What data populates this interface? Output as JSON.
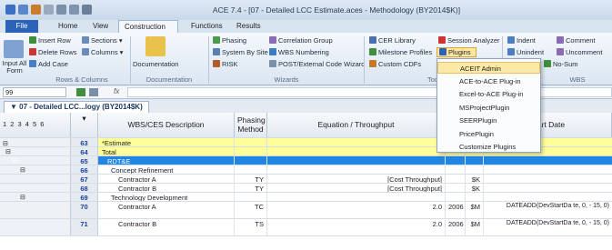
{
  "window": {
    "title": "ACE 7.4 - [07 - Detailed LCC Estimate.aces - Methodology (BY2014$K)]"
  },
  "tabs": [
    {
      "label": "File"
    },
    {
      "label": "Home"
    },
    {
      "label": "View"
    },
    {
      "label": "Construction"
    },
    {
      "label": "Functions"
    },
    {
      "label": "Results"
    }
  ],
  "ribbon": {
    "input_all": "Input All Form",
    "insert_row": "Insert Row",
    "delete_rows": "Delete Rows",
    "add_case": "Add Case",
    "sections": "Sections",
    "columns": "Columns",
    "documentation": "Documentation",
    "phasing": "Phasing",
    "system_by_site": "System By Site",
    "risk": "RISK",
    "correlation_group": "Correlation Group",
    "wbs_numbering": "WBS Numbering",
    "post_external": "POST/External Code Wizard",
    "cer_library": "CER Library",
    "milestone_profiles": "Milestone Profiles",
    "custom_cdfs": "Custom CDFs",
    "session_analyzer": "Session Analyzer",
    "plugins": "Plugins",
    "indent": "Indent",
    "unindent": "Unindent",
    "comment": "Comment",
    "uncomment": "Uncomment",
    "no_sum": "No-Sum",
    "groups": {
      "rows_columns": "Rows & Columns",
      "documentation": "Documentation",
      "wizards": "Wizards",
      "tools": "Too",
      "wbs": "WBS"
    }
  },
  "formula": {
    "name_box": "99"
  },
  "doc_tab": {
    "label": "07 - Detailed LCC...logy (BY2014$K)"
  },
  "grid": {
    "levels": "1 2 3 4 5 6",
    "columns": {
      "desc": "WBS/CES Description",
      "phasing": "Phasing Method",
      "equation": "Equation / Throughput",
      "start": "Start Date"
    },
    "rows": [
      {
        "num": "63",
        "desc": "*Estimate",
        "phasing": "",
        "eq": "",
        "year": "",
        "unit": "",
        "start": ""
      },
      {
        "num": "64",
        "desc": "Total",
        "phasing": "",
        "eq": "",
        "year": "",
        "unit": "",
        "start": ""
      },
      {
        "num": "65",
        "desc": "RDT&E",
        "phasing": "",
        "eq": "",
        "year": "",
        "unit": "",
        "start": ""
      },
      {
        "num": "66",
        "desc": "Concept Refinement",
        "phasing": "",
        "eq": "",
        "year": "",
        "unit": "",
        "start": ""
      },
      {
        "num": "67",
        "desc": "Contractor A",
        "phasing": "TY",
        "eq": "[Cost Throughput]",
        "year": "",
        "unit": "$K",
        "start": ""
      },
      {
        "num": "68",
        "desc": "Contractor B",
        "phasing": "TY",
        "eq": "[Cost Throughput]",
        "year": "",
        "unit": "$K",
        "start": ""
      },
      {
        "num": "69",
        "desc": "Technology Development",
        "phasing": "",
        "eq": "",
        "year": "",
        "unit": "",
        "start": ""
      },
      {
        "num": "70",
        "desc": "Contractor A",
        "phasing": "TC",
        "eq": "2.0",
        "year": "2006",
        "unit": "$M",
        "start": "DATEADD(DevStartDa te, 0, - 15, 0)"
      },
      {
        "num": "71",
        "desc": "Contractor B",
        "phasing": "TS",
        "eq": "2.0",
        "year": "2006",
        "unit": "$M",
        "start": "DATEADD(DevStartDa te, 0, - 15, 0)"
      }
    ]
  },
  "plugins_menu": {
    "items": [
      {
        "label": "ACEIT Admin"
      },
      {
        "label": "ACE-to-ACE Plug-in"
      },
      {
        "label": "Excel-to-ACE Plug-in"
      },
      {
        "label": "MSProjectPlugin"
      },
      {
        "label": "SEERPlugin"
      },
      {
        "label": "PricePlugin"
      },
      {
        "label": "Customize Plugins"
      }
    ]
  },
  "colors": {
    "accent": "#2a63b8",
    "highlight_yellow": "#ffff99",
    "selected_row": "#1f86e5"
  }
}
